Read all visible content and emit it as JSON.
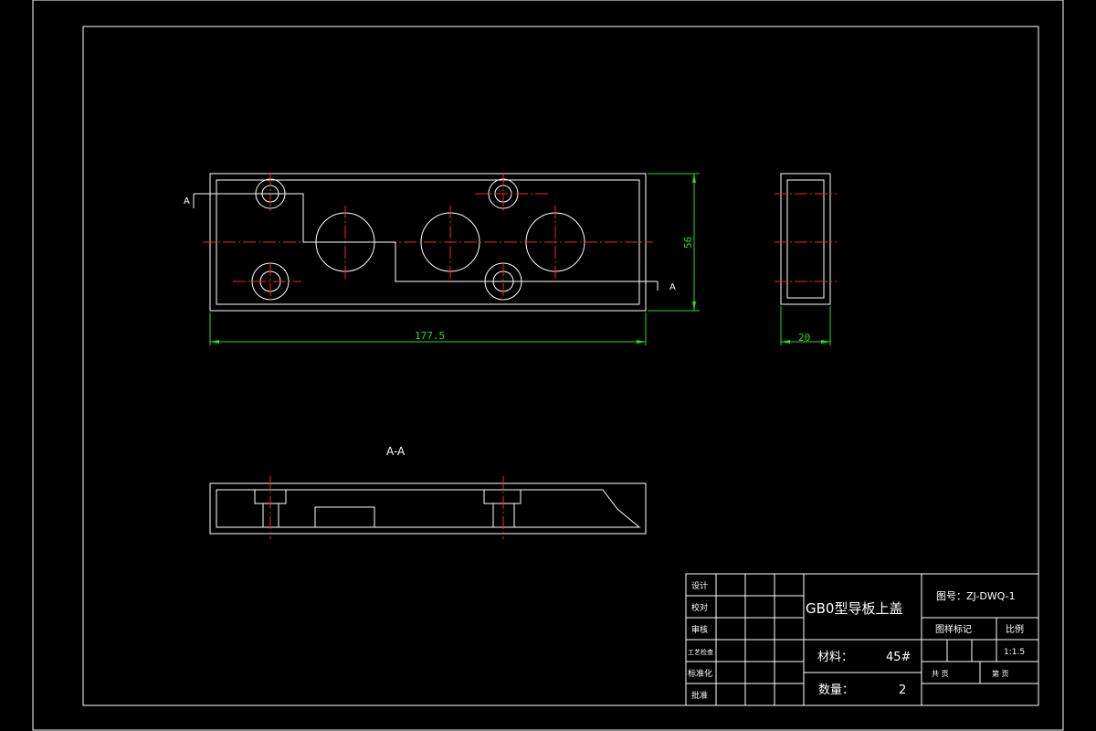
{
  "dimensions": {
    "length": "177.5",
    "height": "56",
    "thickness": "20"
  },
  "section": {
    "label": "A-A",
    "cut_mark": "A"
  },
  "title_block": {
    "part_name": "GB0型导板上盖",
    "drawing_no": "图号：ZJ-DWQ-1",
    "material_label": "材料：",
    "material_value": "45#",
    "quantity_label": "数量：",
    "quantity_value": "2",
    "sample_mark": "图样标记",
    "scale_label": "比例",
    "scale_value": "1:1.5",
    "sheets_total": "共   页",
    "sheet_no": "第   页",
    "roles": [
      "设计",
      "校对",
      "审核",
      "工艺检查",
      "标准化",
      "批准"
    ]
  },
  "colors": {
    "outline": "#ffffff",
    "hatch": "#3fd7d7",
    "centerline": "#ff2020",
    "dimension": "#20e020",
    "section_hatch": "#e0e020"
  }
}
